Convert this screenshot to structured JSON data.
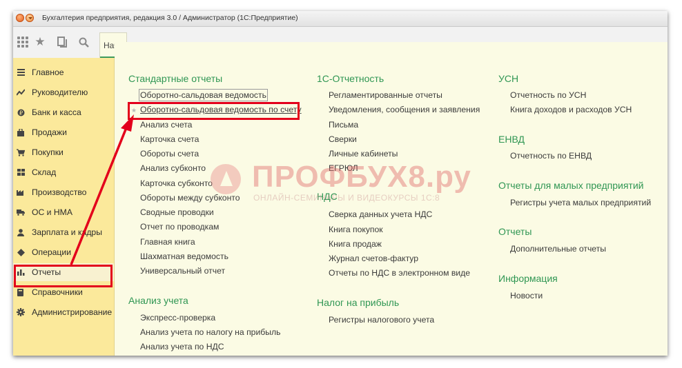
{
  "window": {
    "title": "Бухгалтерия предприятия, редакция 3.0 / Администратор  (1С:Предприятие)"
  },
  "toolbar": {
    "home_tab_label": "Начальная страница"
  },
  "sidebar": {
    "items": [
      {
        "label": "Главное",
        "icon": "menu-lines-icon"
      },
      {
        "label": "Руководителю",
        "icon": "trend-icon"
      },
      {
        "label": "Банк и касса",
        "icon": "coin-icon"
      },
      {
        "label": "Продажи",
        "icon": "shopping-bag-icon"
      },
      {
        "label": "Покупки",
        "icon": "cart-icon"
      },
      {
        "label": "Склад",
        "icon": "warehouse-icon"
      },
      {
        "label": "Производство",
        "icon": "factory-icon"
      },
      {
        "label": "ОС и НМА",
        "icon": "truck-icon"
      },
      {
        "label": "Зарплата и кадры",
        "icon": "person-icon"
      },
      {
        "label": "Операции",
        "icon": "operations-icon"
      },
      {
        "label": "Отчеты",
        "icon": "bar-chart-icon",
        "active": true
      },
      {
        "label": "Справочники",
        "icon": "book-icon"
      },
      {
        "label": "Администрирование",
        "icon": "gear-icon"
      }
    ]
  },
  "sections": {
    "standard_reports": {
      "title": "Стандартные отчеты",
      "items": [
        "Оборотно-сальдовая ведомость",
        "Оборотно-сальдовая ведомость по счету",
        "Анализ счета",
        "Карточка счета",
        "Обороты счета",
        "Анализ субконто",
        "Карточка субконто",
        "Обороты между субконто",
        "Сводные проводки",
        "Отчет по проводкам",
        "Главная книга",
        "Шахматная ведомость",
        "Универсальный отчет"
      ]
    },
    "accounting_analysis": {
      "title": "Анализ учета",
      "items": [
        "Экспресс-проверка",
        "Анализ учета по налогу на прибыль",
        "Анализ учета по НДС"
      ]
    },
    "reporting_1c": {
      "title": "1С-Отчетность",
      "items": [
        "Регламентированные отчеты",
        "Уведомления, сообщения и заявления",
        "Письма",
        "Сверки",
        "Личные кабинеты",
        "ЕГРЮЛ"
      ]
    },
    "vat": {
      "title": "НДС",
      "items": [
        "Сверка данных учета НДС",
        "Книга покупок",
        "Книга продаж",
        "Журнал счетов-фактур",
        "Отчеты по НДС в электронном виде"
      ]
    },
    "profit_tax": {
      "title": "Налог на прибыль",
      "items": [
        "Регистры налогового учета"
      ]
    },
    "usn": {
      "title": "УСН",
      "items": [
        "Отчетность по УСН",
        "Книга доходов и расходов УСН"
      ]
    },
    "envd": {
      "title": "ЕНВД",
      "items": [
        "Отчетность по ЕНВД"
      ]
    },
    "small_business": {
      "title": "Отчеты для малых предприятий",
      "items": [
        "Регистры учета малых предприятий"
      ]
    },
    "reports": {
      "title": "Отчеты",
      "items": [
        "Дополнительные отчеты"
      ]
    },
    "information": {
      "title": "Информация",
      "items": [
        "Новости"
      ]
    }
  },
  "watermark": {
    "title": "ПРОФБУХ8.ру",
    "subtitle": "ОНЛАЙН-СЕМИНАРЫ И ВИДЕОКУРСЫ 1С:8"
  },
  "colors": {
    "accent_green": "#2f9653",
    "sidebar_yellow": "#fbe99b",
    "content_bg": "#fbfbe4",
    "highlight_red": "#e3001b"
  }
}
